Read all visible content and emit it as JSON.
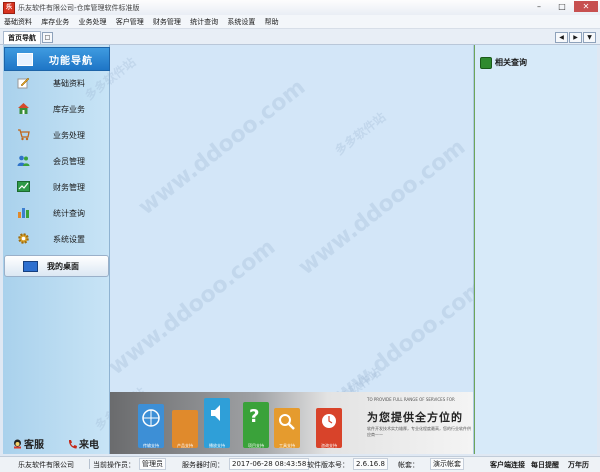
{
  "window": {
    "app_icon_text": "乐",
    "title": "乐友软件有限公司-仓库管理软件标准版"
  },
  "menu": [
    "基础资料",
    "库存业务",
    "业务处理",
    "客户管理",
    "财务管理",
    "统计查询",
    "系统设置",
    "帮助"
  ],
  "tabs": {
    "active": "首页导航"
  },
  "sidebar": {
    "header": "功能导航",
    "items": [
      {
        "label": "基础资料",
        "icon": "edit-icon",
        "color": "#e0a020"
      },
      {
        "label": "库存业务",
        "icon": "warehouse-icon",
        "color": "#3a8f3a"
      },
      {
        "label": "业务处理",
        "icon": "cart-icon",
        "color": "#d87a1a"
      },
      {
        "label": "会员管理",
        "icon": "users-icon",
        "color": "#2f73c9"
      },
      {
        "label": "财务管理",
        "icon": "finance-chart-icon",
        "color": "#2e9a48"
      },
      {
        "label": "统计查询",
        "icon": "bar-chart-icon",
        "color": "#3d7fd0"
      },
      {
        "label": "系统设置",
        "icon": "gear-icon",
        "color": "#d8a12a"
      }
    ],
    "my_desktop": "我的桌面",
    "bottom": {
      "customer_service": "客服",
      "incoming_call": "来电"
    }
  },
  "content": {
    "watermark": "www.ddooo.com",
    "watermark2": "多多软件站",
    "banner": {
      "subtitle": "TO PROVIDE FULL RANGE OF SERVICES FOR",
      "title": "为您提供全方位的",
      "desc": "软件开发技术实力雄厚，专业化程度最高，您的行业软件供应商——",
      "panels": [
        {
          "label": "传输支持",
          "color": "#3d8fd6"
        },
        {
          "label": "产品支持",
          "color": "#e08a2c"
        },
        {
          "label": "播放支持",
          "color": "#2f9fd8"
        },
        {
          "label": "项目支持",
          "color": "#3aa23a"
        },
        {
          "label": "工具支持",
          "color": "#e59b2e"
        },
        {
          "label": "咨询支持",
          "color": "#d8432a"
        }
      ]
    }
  },
  "right_panel": {
    "title": "相关查询"
  },
  "status": {
    "company": "乐友软件有限公司",
    "operator_label": "当前操作员：",
    "operator": "管理员",
    "server_time_label": "服务器时间：",
    "server_time": "2017-06-28 08:43:58",
    "version_label": "软件版本号：",
    "version": "2.6.16.8",
    "account_label": "帐套：",
    "account": "演示帐套",
    "client_status": "客户端连接",
    "daily_reminder": "每日提醒",
    "calendar": "万年历"
  }
}
